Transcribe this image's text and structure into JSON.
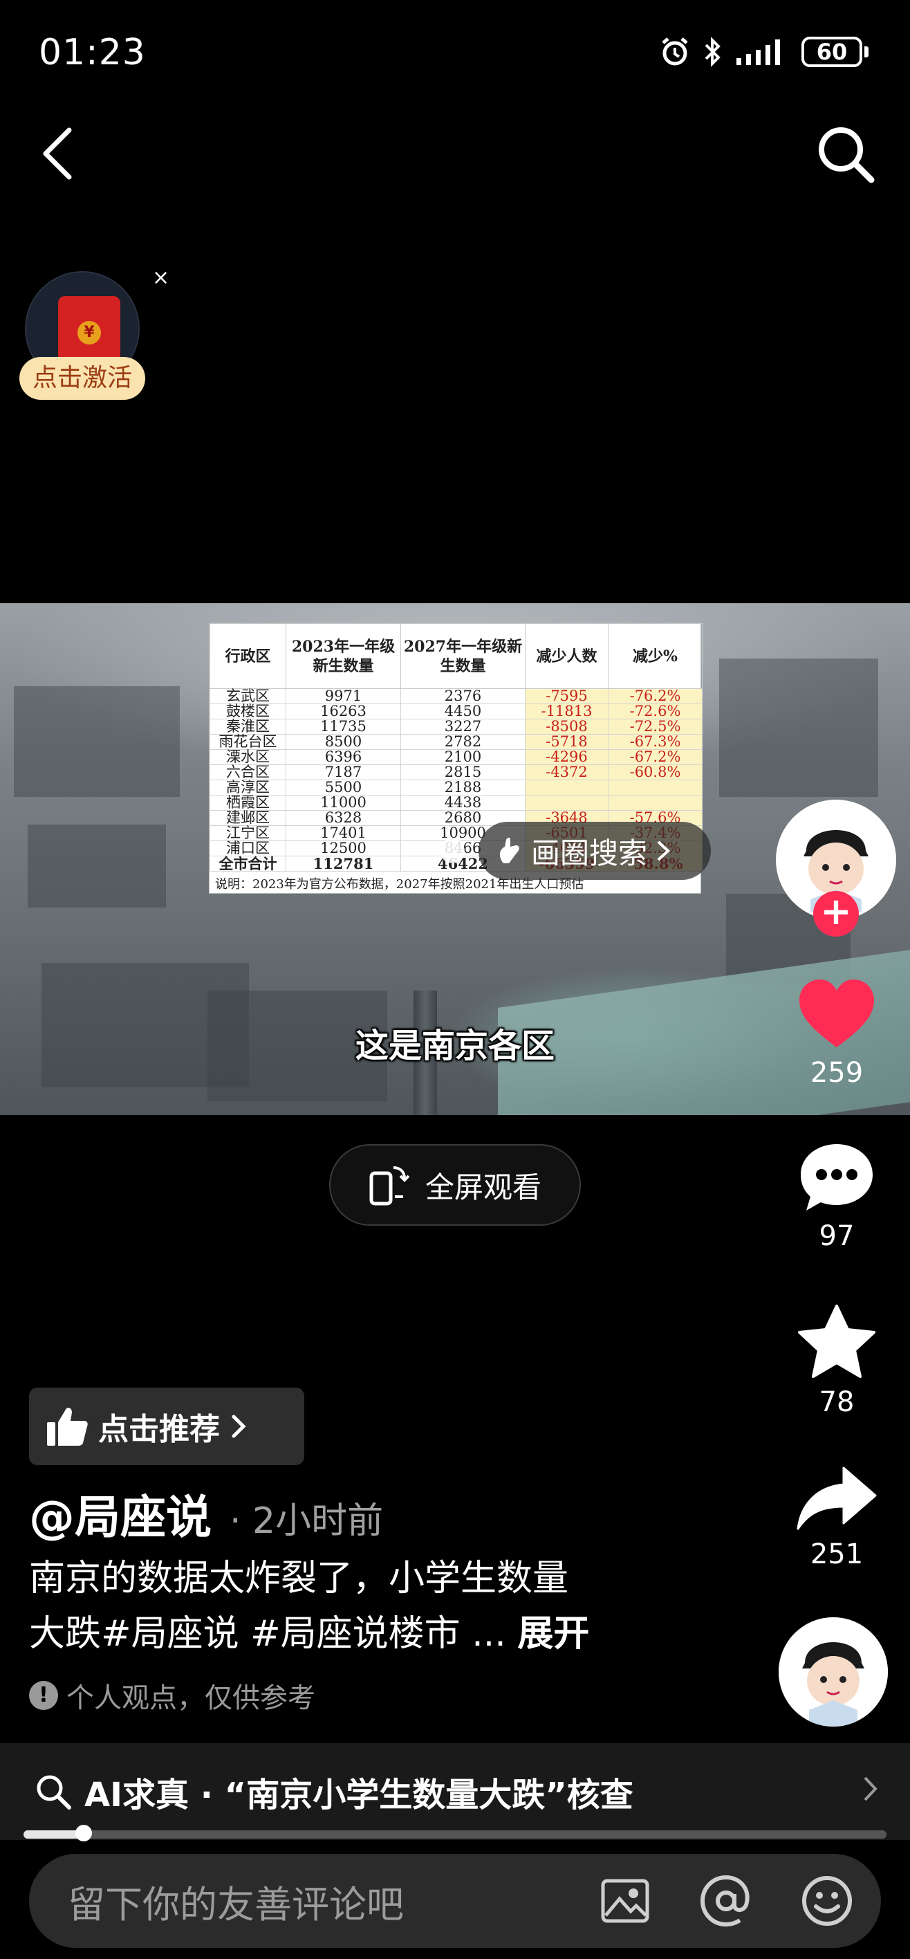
{
  "status_bar": {
    "time": "01:23",
    "battery": "60"
  },
  "red_packet": {
    "label": "点击激活",
    "close_glyph": "×",
    "seal": "¥"
  },
  "video": {
    "table": {
      "headers": [
        "行政区",
        "2023年一年级新生数量",
        "2027年一年级新生数量",
        "减少人数",
        "减少%"
      ],
      "rows": [
        [
          "玄武区",
          "9971",
          "2376",
          "-7595",
          "-76.2%"
        ],
        [
          "鼓楼区",
          "16263",
          "4450",
          "-11813",
          "-72.6%"
        ],
        [
          "秦淮区",
          "11735",
          "3227",
          "-8508",
          "-72.5%"
        ],
        [
          "雨花台区",
          "8500",
          "2782",
          "-5718",
          "-67.3%"
        ],
        [
          "溧水区",
          "6396",
          "2100",
          "-4296",
          "-67.2%"
        ],
        [
          "六合区",
          "7187",
          "2815",
          "-4372",
          "-60.8%"
        ],
        [
          "高淳区",
          "5500",
          "2188",
          "",
          ""
        ],
        [
          "栖霞区",
          "11000",
          "4438",
          "",
          ""
        ],
        [
          "建邺区",
          "6328",
          "2680",
          "-3648",
          "-57.6%"
        ],
        [
          "江宁区",
          "17401",
          "10900",
          "-6501",
          "-37.4%"
        ],
        [
          "浦口区",
          "12500",
          "8466",
          "-4034",
          "-32.3%"
        ],
        [
          "全市合计",
          "112781",
          "46422",
          "-66359",
          "-58.8%"
        ]
      ],
      "note": "说明：2023年为官方公布数据，2027年按照2021年出生人口预估"
    },
    "circle_search_label": "画圈搜索",
    "subtitle": "这是南京各区"
  },
  "rail": {
    "likes": "259",
    "comments": "97",
    "favorites": "78",
    "shares": "251"
  },
  "fullscreen_label": "全屏观看",
  "recommend_label": "点击推荐",
  "author": {
    "name": "@局座说",
    "time": "· 2小时前"
  },
  "description": {
    "line1": "南京的数据太炸裂了，小学生数量",
    "line2": "大跌#局座说 #局座说楼市 ... ",
    "expand": "展开"
  },
  "disclaimer": "个人观点，仅供参考",
  "ai_bar": {
    "label": "AI求真 · “南京小学生数量大跌”核查"
  },
  "progress": 0.07,
  "comment": {
    "placeholder": "留下你的友善评论吧"
  },
  "colors": {
    "like_red": "#fe2c55",
    "table_highlight": "#fbf3c2",
    "table_red_text": "#c8201d"
  },
  "icons": [
    "back-icon",
    "search-icon",
    "heart-icon",
    "comment-icon",
    "star-icon",
    "share-icon",
    "thumb-up-icon",
    "fullscreen-icon",
    "image-icon",
    "at-icon",
    "emoji-icon"
  ]
}
